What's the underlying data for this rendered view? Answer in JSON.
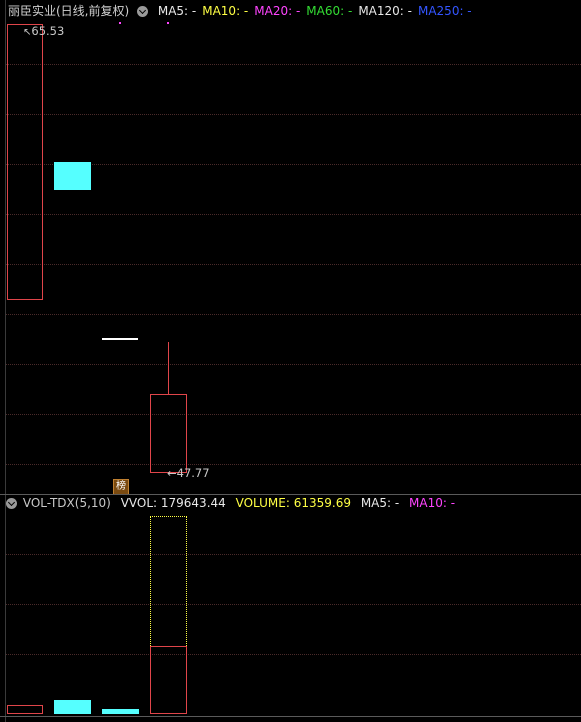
{
  "header": {
    "title": "丽臣实业(日线,前复权)",
    "ma": [
      {
        "label": "MA5:",
        "value": "-",
        "color": "#e8e8e8"
      },
      {
        "label": "MA10:",
        "value": "-",
        "color": "#ffff44"
      },
      {
        "label": "MA20:",
        "value": "-",
        "color": "#ff44ff"
      },
      {
        "label": "MA60:",
        "value": "-",
        "color": "#33dd33"
      },
      {
        "label": "MA120:",
        "value": "-",
        "color": "#e8e8e8"
      },
      {
        "label": "MA250:",
        "value": "-",
        "color": "#3355ff"
      }
    ]
  },
  "price": {
    "high_label": "65.53",
    "low_label": "47.77",
    "badge": "榜"
  },
  "vol_header": {
    "name": "VOL-TDX(5,10)",
    "vvol": "VVOL: 179643.44",
    "volume": "VOLUME: 61359.69",
    "ma5": "MA5: -",
    "ma10": "MA10: -"
  },
  "colors": {
    "up": "#e0454a",
    "down": "#55ffff",
    "background": "#000000"
  },
  "footer_partial": "MA5 ... (cut off)"
}
